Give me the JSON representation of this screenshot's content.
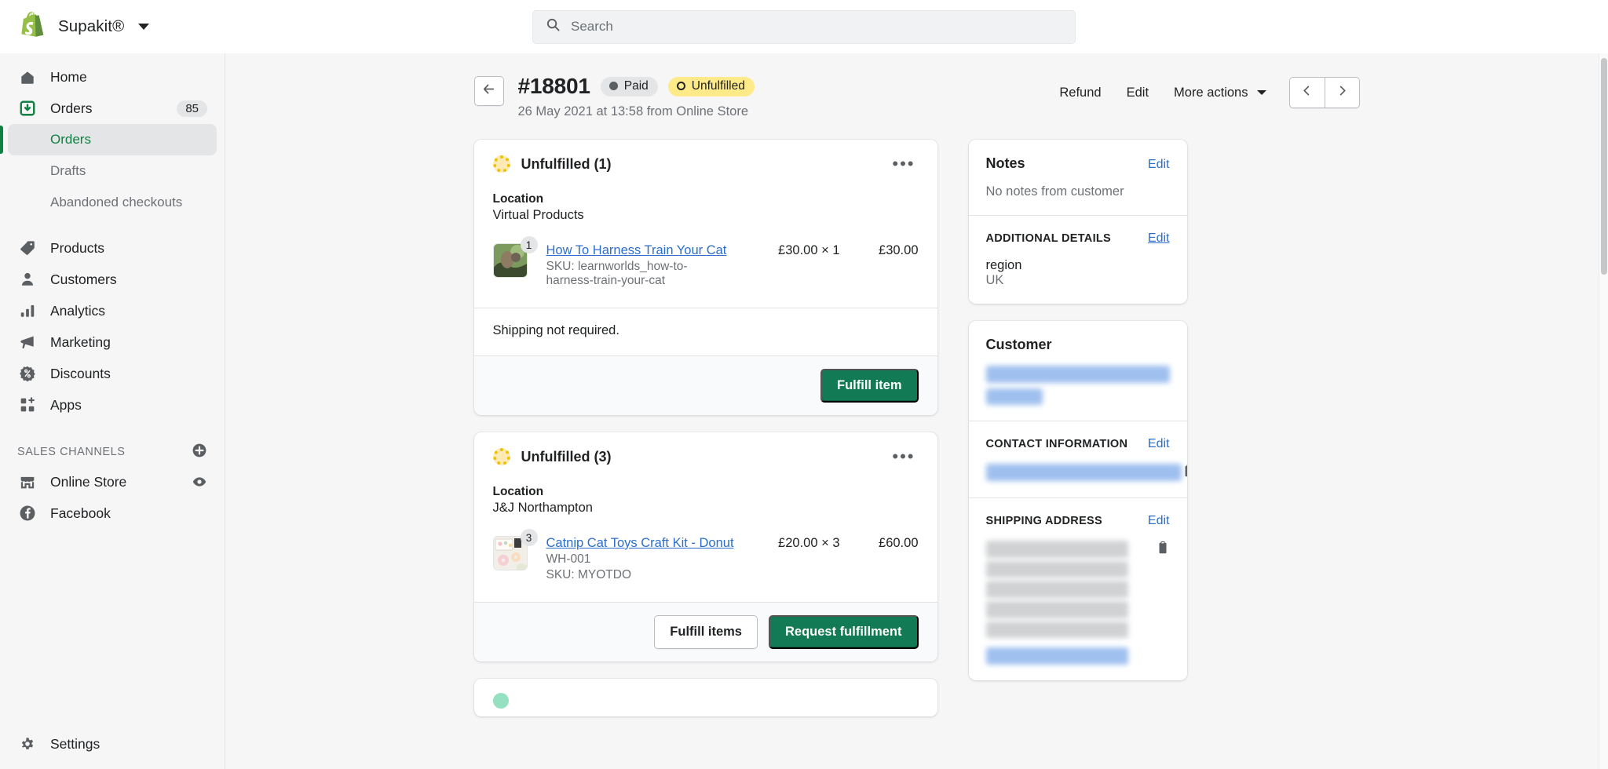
{
  "topbar": {
    "shop_name": "Supakit®",
    "logo_icon": "shopify-logo",
    "store_switcher_icon": "chevron-down-icon",
    "search": {
      "icon": "search-icon",
      "placeholder": "Search",
      "value": ""
    }
  },
  "sidebar": {
    "items": [
      {
        "label": "Home",
        "icon": "home-icon",
        "badge": ""
      },
      {
        "label": "Orders",
        "icon": "orders-inbox-icon",
        "badge": "85"
      },
      {
        "label": "Products",
        "icon": "tag-icon",
        "badge": ""
      },
      {
        "label": "Customers",
        "icon": "person-icon",
        "badge": ""
      },
      {
        "label": "Analytics",
        "icon": "bar-chart-icon",
        "badge": ""
      },
      {
        "label": "Marketing",
        "icon": "megaphone-icon",
        "badge": ""
      },
      {
        "label": "Discounts",
        "icon": "discount-percent-icon",
        "badge": ""
      },
      {
        "label": "Apps",
        "icon": "apps-grid-plus-icon",
        "badge": ""
      }
    ],
    "orders_subitems": [
      {
        "label": "Orders",
        "active": true
      },
      {
        "label": "Drafts",
        "active": false
      },
      {
        "label": "Abandoned checkouts",
        "active": false
      }
    ],
    "sales_channels": {
      "title": "SALES CHANNELS",
      "add_icon": "plus-circle-icon",
      "items": [
        {
          "label": "Online Store",
          "icon": "storefront-icon",
          "trailing_icon": "eye-icon"
        },
        {
          "label": "Facebook",
          "icon": "facebook-icon",
          "trailing_icon": ""
        }
      ]
    },
    "settings": {
      "label": "Settings",
      "icon": "gear-icon"
    }
  },
  "page_header": {
    "back_icon": "arrow-left-icon",
    "order_number": "#18801",
    "badges": [
      {
        "label": "Paid",
        "style": "paid",
        "icon": "dot-filled-icon"
      },
      {
        "label": "Unfulfilled",
        "style": "unfulfilled",
        "icon": "dot-ring-icon"
      }
    ],
    "meta": "26 May 2021 at 13:58 from Online Store",
    "actions": [
      {
        "label": "Refund"
      },
      {
        "label": "Edit"
      },
      {
        "label": "More actions",
        "icon": "chevron-down-icon"
      }
    ],
    "pager": {
      "prev_icon": "chevron-left-icon",
      "next_icon": "chevron-right-icon"
    }
  },
  "fulfillments": [
    {
      "status_icon": "unfulfilled-donut-icon",
      "title": "Unfulfilled (1)",
      "kebab_icon": "ellipsis-icon",
      "location_label": "Location",
      "location_value": "Virtual Products",
      "items": [
        {
          "qty_bubble": "1",
          "name": "How To Harness Train Your Cat",
          "sub1": "SKU: learnworlds_how-to-harness-train-your-cat",
          "sub2": "",
          "unit_price": "£30.00 × 1",
          "line_total": "£30.00",
          "thumb": "cat-harness-photo"
        }
      ],
      "note": "Shipping not required.",
      "buttons": [
        {
          "label": "Fulfill item",
          "variant": "primary"
        }
      ]
    },
    {
      "status_icon": "unfulfilled-donut-icon",
      "title": "Unfulfilled (3)",
      "kebab_icon": "ellipsis-icon",
      "location_label": "Location",
      "location_value": "J&J Northampton",
      "items": [
        {
          "qty_bubble": "3",
          "name": "Catnip Cat Toys Craft Kit - Donut",
          "sub1": "WH-001",
          "sub2": "SKU: MYOTDO",
          "unit_price": "£20.00 × 3",
          "line_total": "£60.00",
          "thumb": "donut-craft-kit-photo"
        }
      ],
      "note": "",
      "buttons": [
        {
          "label": "Fulfill items",
          "variant": "default"
        },
        {
          "label": "Request fulfillment",
          "variant": "primary"
        }
      ]
    }
  ],
  "side_panels": {
    "notes": {
      "title": "Notes",
      "edit_label": "Edit",
      "body": "No notes from customer"
    },
    "additional_details": {
      "title": "ADDITIONAL DETAILS",
      "edit_label": "Edit",
      "key": "region",
      "value": "UK"
    },
    "customer": {
      "title": "Customer",
      "name_redacted": "██████████████",
      "orders_redacted": "█████████"
    },
    "contact_information": {
      "title": "CONTACT INFORMATION",
      "edit_label": "Edit",
      "email_redacted": "██████████████████████",
      "copy_icon": "clipboard-icon"
    },
    "shipping_address": {
      "title": "SHIPPING ADDRESS",
      "edit_label": "Edit",
      "copy_icon": "clipboard-icon",
      "lines_redacted": [
        "██████████████",
        "█████████████",
        "████████████████",
        "███████████████",
        "████████████"
      ],
      "map_link_redacted": "██████████"
    }
  },
  "colors": {
    "brand_green": "#127a54",
    "accent_link": "#2c6ecb",
    "warning_yellow": "#ffea8a",
    "surface": "#ffffff",
    "background": "#f6f6f7",
    "active_nav": "#108043"
  }
}
